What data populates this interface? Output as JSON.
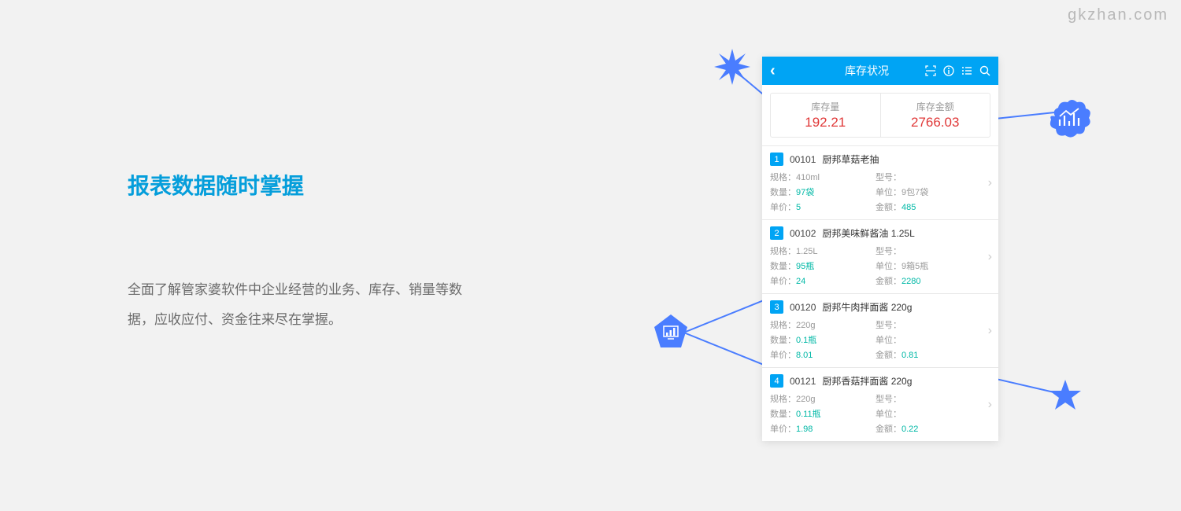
{
  "watermark": "gkzhan.com",
  "heading": "报表数据随时掌握",
  "description": "全面了解管家婆软件中企业经营的业务、库存、销量等数据，应收应付、资金往来尽在掌握。",
  "phone": {
    "title": "库存状况",
    "summary": {
      "stock_qty_label": "库存量",
      "stock_qty_value": "192.21",
      "stock_amount_label": "库存金额",
      "stock_amount_value": "2766.03"
    },
    "labels": {
      "spec": "规格：",
      "model": "型号：",
      "qty": "数量：",
      "unit": "单位：",
      "price": "单价：",
      "amount": "金额："
    },
    "items": [
      {
        "num": "1",
        "code": "00101",
        "name": "厨邦草菇老抽",
        "spec": "410ml",
        "model": "",
        "qty": "97袋",
        "unit": "9包7袋",
        "price": "5",
        "amount": "485"
      },
      {
        "num": "2",
        "code": "00102",
        "name": "厨邦美味鲜酱油 1.25L",
        "spec": "1.25L",
        "model": "",
        "qty": "95瓶",
        "unit": "9箱5瓶",
        "price": "24",
        "amount": "2280"
      },
      {
        "num": "3",
        "code": "00120",
        "name": "厨邦牛肉拌面酱 220g",
        "spec": "220g",
        "model": "",
        "qty": "0.1瓶",
        "unit": "",
        "price": "8.01",
        "amount": "0.81"
      },
      {
        "num": "4",
        "code": "00121",
        "name": "厨邦香菇拌面酱 220g",
        "spec": "220g",
        "model": "",
        "qty": "0.11瓶",
        "unit": "",
        "price": "1.98",
        "amount": "0.22"
      }
    ]
  }
}
